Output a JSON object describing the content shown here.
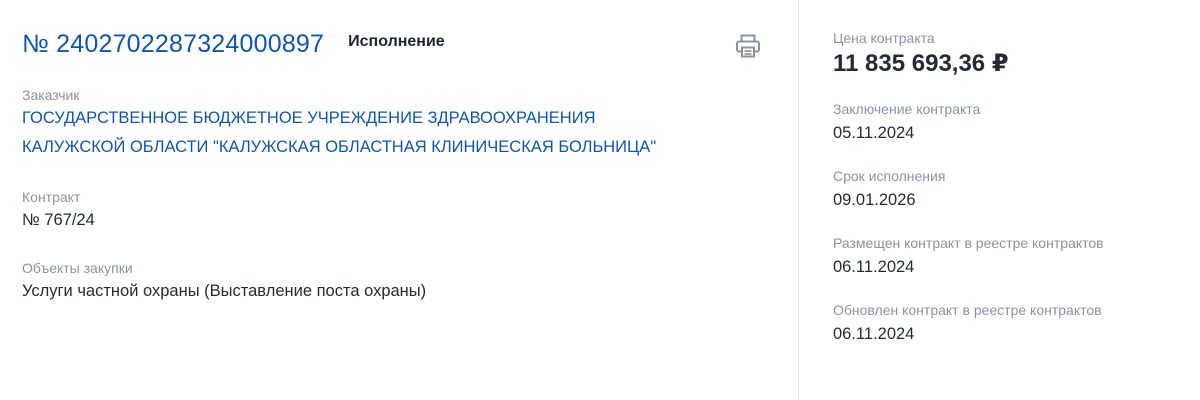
{
  "header": {
    "contract_number": "№ 2402702287324000897",
    "status": "Исполнение",
    "print_icon": "printer-icon"
  },
  "customer": {
    "label": "Заказчик",
    "line1": "ГОСУДАРСТВЕННОЕ БЮДЖЕТНОЕ УЧРЕЖДЕНИЕ ЗДРАВООХРАНЕНИЯ",
    "line2": "КАЛУЖСКОЙ ОБЛАСТИ \"КАЛУЖСКАЯ ОБЛАСТНАЯ КЛИНИЧЕСКАЯ БОЛЬНИЦА\""
  },
  "contract": {
    "label": "Контракт",
    "value": "№ 767/24"
  },
  "objects": {
    "label": "Объекты закупки",
    "value": "Услуги частной охраны (Выставление поста охраны)"
  },
  "side": {
    "price_label": "Цена контракта",
    "price_value": "11 835 693,36 ₽",
    "conclusion_label": "Заключение контракта",
    "conclusion_value": "05.11.2024",
    "execution_label": "Срок исполнения",
    "execution_value": "09.01.2026",
    "placed_label": "Размещен контракт в реестре контрактов",
    "placed_value": "06.11.2024",
    "updated_label": "Обновлен контракт в реестре контрактов",
    "updated_value": "06.11.2024"
  },
  "colors": {
    "link": "#0d56b6",
    "text": "#242b38",
    "label": "#8b93a3",
    "divider": "#e3e7ee"
  }
}
